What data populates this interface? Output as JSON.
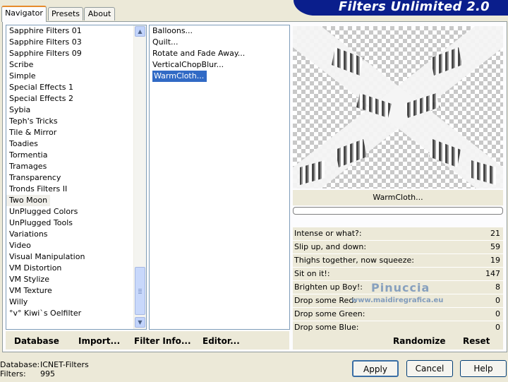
{
  "window": {
    "title": "Filters Unlimited 2.0"
  },
  "tabs": [
    {
      "label": "Navigator",
      "active": true
    },
    {
      "label": "Presets",
      "active": false
    },
    {
      "label": "About",
      "active": false
    }
  ],
  "categories": [
    "Sapphire Filters 01",
    "Sapphire Filters 03",
    "Sapphire Filters 09",
    "Scribe",
    "Simple",
    "Special Effects 1",
    "Special Effects 2",
    "Sybia",
    "Teph's Tricks",
    "Tile & Mirror",
    "Toadies",
    "Tormentia",
    "Tramages",
    "Transparency",
    "Tronds Filters II",
    "Two Moon",
    "UnPlugged Colors",
    "UnPlugged Tools",
    "Variations",
    "Video",
    "Visual Manipulation",
    "VM Distortion",
    "VM Stylize",
    "VM Texture",
    "Willy",
    "°v° Kiwi`s Oelfilter"
  ],
  "selected_category": "Two Moon",
  "filters": [
    "Balloons...",
    "Quilt...",
    "Rotate and Fade Away...",
    "VerticalChopBlur...",
    "WarmCloth..."
  ],
  "selected_filter": "WarmCloth...",
  "left_buttons": {
    "database": "Database",
    "import": "Import...",
    "filter_info": "Filter Info...",
    "editor": "Editor..."
  },
  "filter_name": "WarmCloth...",
  "parameters": [
    {
      "label": "Intense or what?:",
      "value": "21"
    },
    {
      "label": "Slip up, and down:",
      "value": "59"
    },
    {
      "label": "Thighs together, now squeeze:",
      "value": "19"
    },
    {
      "label": "Sit on it!:",
      "value": "147"
    },
    {
      "label": "Brighten up Boy!:",
      "value": "8"
    },
    {
      "label": "Drop some Red:",
      "value": "0"
    },
    {
      "label": "Drop some Green:",
      "value": "0"
    },
    {
      "label": "Drop some Blue:",
      "value": "0"
    }
  ],
  "right_buttons": {
    "randomize": "Randomize",
    "reset": "Reset"
  },
  "watermark": {
    "name": "Pinuccia",
    "site": "www.maidiregrafica.eu"
  },
  "status": {
    "database_label": "Database:",
    "database_value": "ICNET-Filters",
    "filters_label": "Filters:",
    "filters_value": "995"
  },
  "dialog_buttons": {
    "apply": "Apply",
    "cancel": "Cancel",
    "help": "Help"
  },
  "colors": {
    "banner": "#0a1e8c",
    "selection": "#316ac5",
    "face": "#ece9d8"
  }
}
